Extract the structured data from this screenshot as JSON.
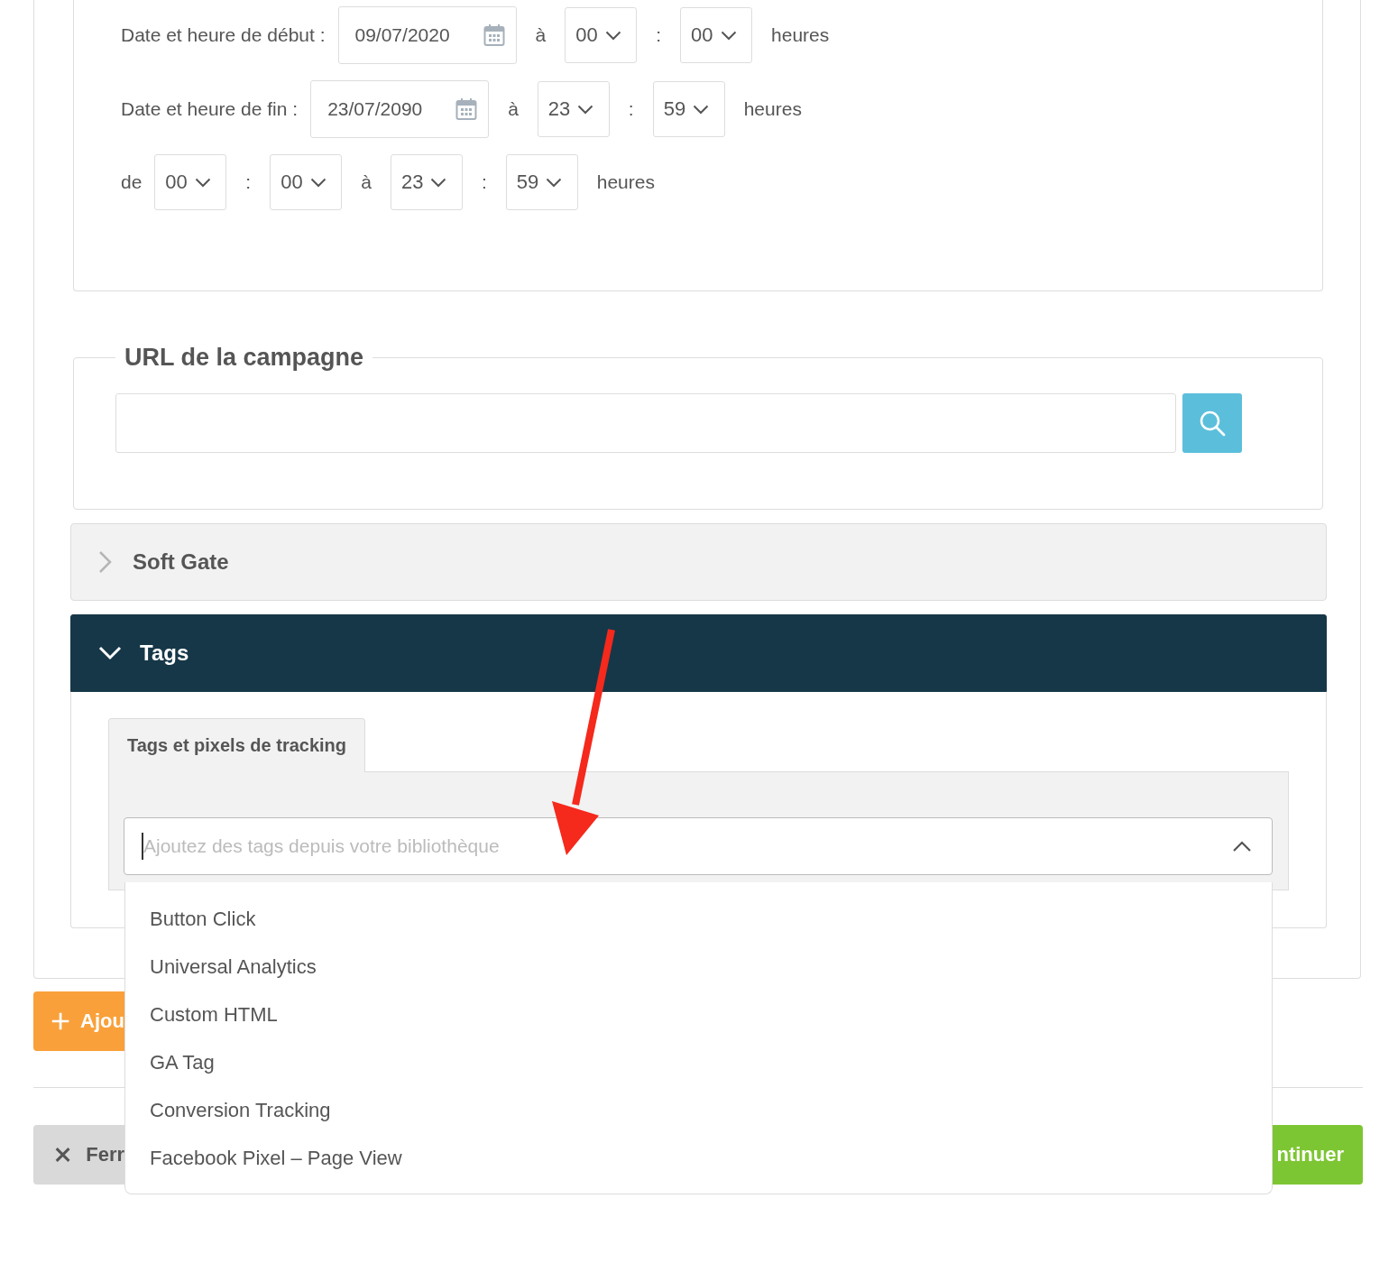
{
  "schedule": {
    "rows": [
      {
        "label": "Date et heure de début :",
        "date": "09/07/2020",
        "parts": [
          {
            "kind": "text",
            "text": "à"
          },
          {
            "kind": "select",
            "value": "00"
          },
          {
            "kind": "text",
            "text": ":"
          },
          {
            "kind": "select",
            "value": "00"
          },
          {
            "kind": "text",
            "text": "heures"
          }
        ]
      },
      {
        "label": "Date et heure de fin :",
        "date": "23/07/2090",
        "parts": [
          {
            "kind": "text",
            "text": "à"
          },
          {
            "kind": "select",
            "value": "23"
          },
          {
            "kind": "text",
            "text": ":"
          },
          {
            "kind": "select",
            "value": "59"
          },
          {
            "kind": "text",
            "text": "heures"
          }
        ]
      },
      {
        "label": "de",
        "parts": [
          {
            "kind": "select",
            "value": "00"
          },
          {
            "kind": "text",
            "text": ":"
          },
          {
            "kind": "select",
            "value": "00"
          },
          {
            "kind": "text",
            "text": "à"
          },
          {
            "kind": "select",
            "value": "23"
          },
          {
            "kind": "text",
            "text": ":"
          },
          {
            "kind": "select",
            "value": "59"
          },
          {
            "kind": "text",
            "text": "heures"
          }
        ]
      }
    ]
  },
  "url_section": {
    "legend": "URL de la campagne"
  },
  "accordions": [
    {
      "title": "Soft Gate",
      "expanded": false
    },
    {
      "title": "Tags",
      "expanded": true,
      "tabs": [
        {
          "label": "Tags et pixels de tracking",
          "selected": true
        }
      ],
      "tag_select": {
        "placeholder": "Ajoutez des tags depuis votre bibliothèque",
        "open": true,
        "options": [
          "Button Click",
          "Universal Analytics",
          "Custom HTML",
          "GA Tag",
          "Conversion Tracking",
          "Facebook Pixel – Page View"
        ]
      }
    }
  ],
  "add_button": {
    "label": "Ajou"
  },
  "close_button": {
    "label": "Ferr"
  },
  "continue_button": {
    "label": "ntinuer"
  }
}
